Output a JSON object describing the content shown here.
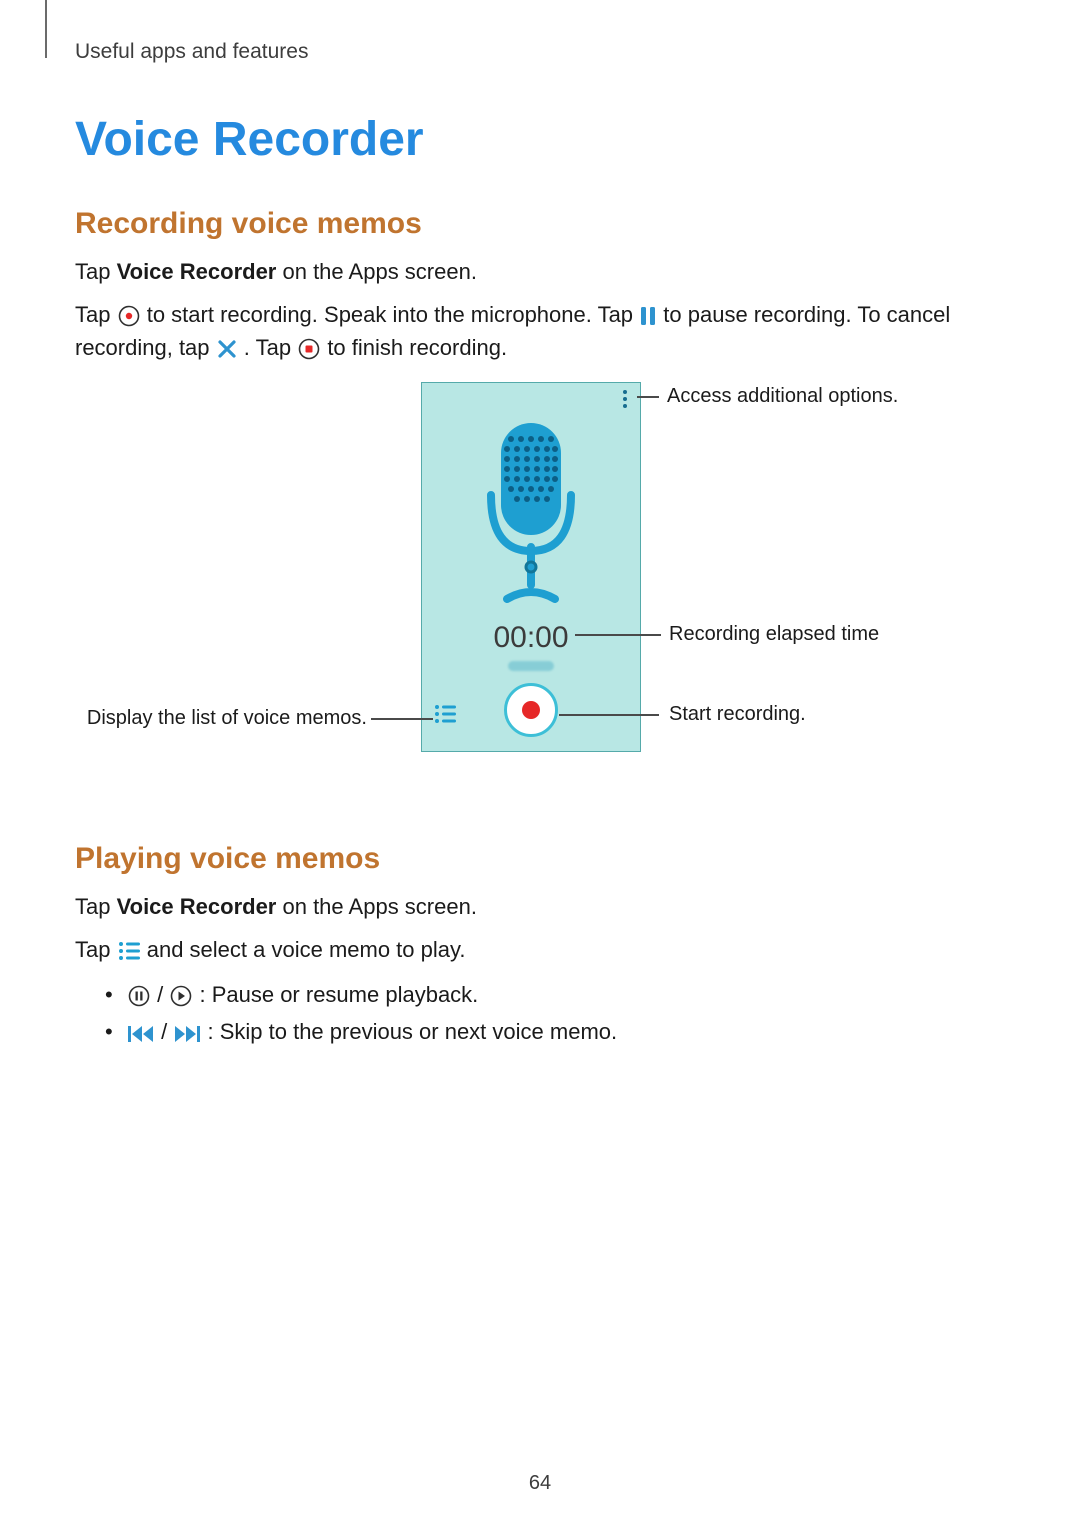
{
  "breadcrumb": "Useful apps and features",
  "title": "Voice Recorder",
  "section_recording": {
    "heading": "Recording voice memos",
    "p1_pre": "Tap ",
    "p1_bold": "Voice Recorder",
    "p1_post": " on the Apps screen.",
    "p2_a": "Tap ",
    "p2_b": " to start recording. Speak into the microphone. Tap ",
    "p2_c": " to pause recording. To cancel recording, tap ",
    "p2_d": ". Tap ",
    "p2_e": " to finish recording."
  },
  "diagram": {
    "elapsed": "00:00",
    "callouts": {
      "options": "Access additional options.",
      "elapsed": "Recording elapsed time",
      "record": "Start recording.",
      "list": "Display the list of voice memos."
    }
  },
  "section_playing": {
    "heading": "Playing voice memos",
    "p1_pre": "Tap ",
    "p1_bold": "Voice Recorder",
    "p1_post": " on the Apps screen.",
    "p2_a": "Tap ",
    "p2_b": " and select a voice memo to play.",
    "bullet1_mid": " / ",
    "bullet1_post": " : Pause or resume playback.",
    "bullet2_mid": " / ",
    "bullet2_post": " : Skip to the previous or next voice memo."
  },
  "page_number": "64"
}
